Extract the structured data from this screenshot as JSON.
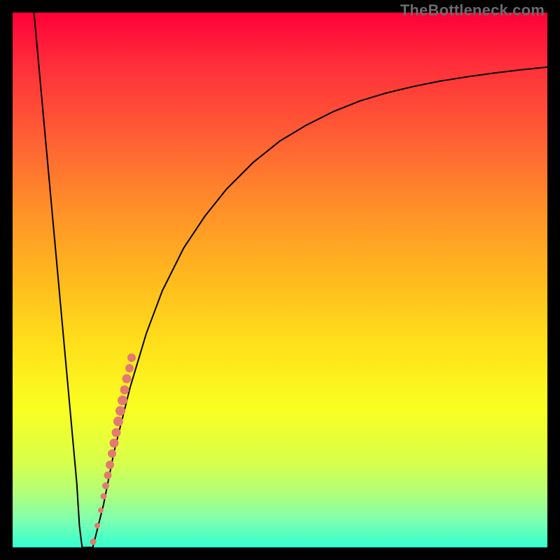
{
  "watermark": "TheBottleneck.com",
  "colors": {
    "curve_stroke": "#000000",
    "point_fill": "#e47a6f",
    "frame_bg": "#000000"
  },
  "chart_data": {
    "type": "line",
    "title": "",
    "xlabel": "",
    "ylabel": "",
    "xlim": [
      0,
      100
    ],
    "ylim": [
      0,
      100
    ],
    "gradient_description": "vertical red-to-green heat gradient (top=bad, bottom=good)",
    "curve": {
      "description": "Bottleneck percentage vs relative component rating. The curve drops sharply from 100 at x≈4 to 0 near x≈13, stays at 0 until x≈15, then rises asymptotically toward ~90 as x approaches 100.",
      "x": [
        4,
        6,
        8,
        10,
        12,
        12.5,
        13,
        14,
        15,
        16,
        17,
        18,
        19,
        20,
        22,
        25,
        28,
        32,
        36,
        40,
        45,
        50,
        55,
        60,
        65,
        70,
        75,
        80,
        85,
        90,
        95,
        100
      ],
      "y": [
        100,
        78,
        56,
        34,
        12,
        4,
        0,
        0,
        0,
        4,
        8,
        13,
        18,
        22,
        30,
        40,
        48,
        56,
        62,
        67,
        72,
        76,
        79,
        81.5,
        83.5,
        85,
        86.2,
        87.2,
        88,
        88.7,
        89.3,
        89.8
      ]
    },
    "scatter_points": {
      "description": "Cluster of discrete sample points along the rising portion near the minimum; size in px conveys emphasis.",
      "points": [
        {
          "x": 15.0,
          "y": 1.0,
          "size": 9
        },
        {
          "x": 15.8,
          "y": 4.0,
          "size": 8
        },
        {
          "x": 16.5,
          "y": 7.0,
          "size": 8
        },
        {
          "x": 17.0,
          "y": 9.5,
          "size": 9
        },
        {
          "x": 17.4,
          "y": 11.5,
          "size": 10
        },
        {
          "x": 17.8,
          "y": 13.5,
          "size": 11
        },
        {
          "x": 18.2,
          "y": 15.5,
          "size": 12
        },
        {
          "x": 18.6,
          "y": 17.5,
          "size": 12
        },
        {
          "x": 19.0,
          "y": 19.5,
          "size": 13
        },
        {
          "x": 19.4,
          "y": 21.5,
          "size": 13
        },
        {
          "x": 19.8,
          "y": 23.5,
          "size": 14
        },
        {
          "x": 20.2,
          "y": 25.5,
          "size": 14
        },
        {
          "x": 20.6,
          "y": 27.5,
          "size": 14
        },
        {
          "x": 21.0,
          "y": 29.5,
          "size": 13
        },
        {
          "x": 21.4,
          "y": 31.5,
          "size": 13
        },
        {
          "x": 21.8,
          "y": 33.5,
          "size": 12
        },
        {
          "x": 22.2,
          "y": 35.5,
          "size": 12
        }
      ]
    }
  }
}
